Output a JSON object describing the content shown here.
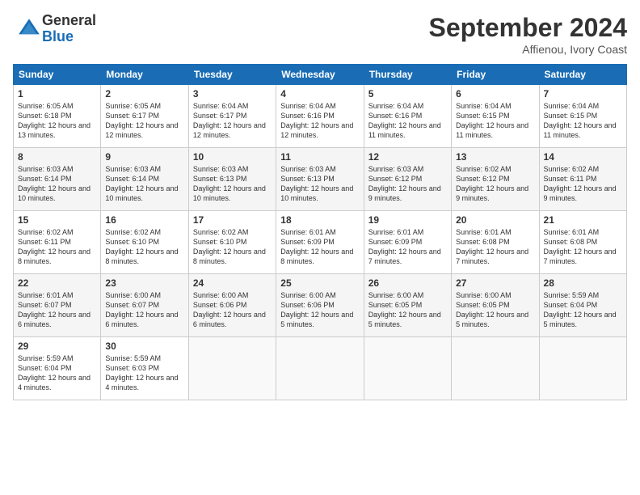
{
  "logo": {
    "general": "General",
    "blue": "Blue"
  },
  "title": "September 2024",
  "location": "Affienou, Ivory Coast",
  "headers": [
    "Sunday",
    "Monday",
    "Tuesday",
    "Wednesday",
    "Thursday",
    "Friday",
    "Saturday"
  ],
  "weeks": [
    [
      {
        "day": "1",
        "rise": "6:05 AM",
        "set": "6:18 PM",
        "daylight": "12 hours and 13 minutes."
      },
      {
        "day": "2",
        "rise": "6:05 AM",
        "set": "6:17 PM",
        "daylight": "12 hours and 12 minutes."
      },
      {
        "day": "3",
        "rise": "6:04 AM",
        "set": "6:17 PM",
        "daylight": "12 hours and 12 minutes."
      },
      {
        "day": "4",
        "rise": "6:04 AM",
        "set": "6:16 PM",
        "daylight": "12 hours and 12 minutes."
      },
      {
        "day": "5",
        "rise": "6:04 AM",
        "set": "6:16 PM",
        "daylight": "12 hours and 11 minutes."
      },
      {
        "day": "6",
        "rise": "6:04 AM",
        "set": "6:15 PM",
        "daylight": "12 hours and 11 minutes."
      },
      {
        "day": "7",
        "rise": "6:04 AM",
        "set": "6:15 PM",
        "daylight": "12 hours and 11 minutes."
      }
    ],
    [
      {
        "day": "8",
        "rise": "6:03 AM",
        "set": "6:14 PM",
        "daylight": "12 hours and 10 minutes."
      },
      {
        "day": "9",
        "rise": "6:03 AM",
        "set": "6:14 PM",
        "daylight": "12 hours and 10 minutes."
      },
      {
        "day": "10",
        "rise": "6:03 AM",
        "set": "6:13 PM",
        "daylight": "12 hours and 10 minutes."
      },
      {
        "day": "11",
        "rise": "6:03 AM",
        "set": "6:13 PM",
        "daylight": "12 hours and 10 minutes."
      },
      {
        "day": "12",
        "rise": "6:03 AM",
        "set": "6:12 PM",
        "daylight": "12 hours and 9 minutes."
      },
      {
        "day": "13",
        "rise": "6:02 AM",
        "set": "6:12 PM",
        "daylight": "12 hours and 9 minutes."
      },
      {
        "day": "14",
        "rise": "6:02 AM",
        "set": "6:11 PM",
        "daylight": "12 hours and 9 minutes."
      }
    ],
    [
      {
        "day": "15",
        "rise": "6:02 AM",
        "set": "6:11 PM",
        "daylight": "12 hours and 8 minutes."
      },
      {
        "day": "16",
        "rise": "6:02 AM",
        "set": "6:10 PM",
        "daylight": "12 hours and 8 minutes."
      },
      {
        "day": "17",
        "rise": "6:02 AM",
        "set": "6:10 PM",
        "daylight": "12 hours and 8 minutes."
      },
      {
        "day": "18",
        "rise": "6:01 AM",
        "set": "6:09 PM",
        "daylight": "12 hours and 8 minutes."
      },
      {
        "day": "19",
        "rise": "6:01 AM",
        "set": "6:09 PM",
        "daylight": "12 hours and 7 minutes."
      },
      {
        "day": "20",
        "rise": "6:01 AM",
        "set": "6:08 PM",
        "daylight": "12 hours and 7 minutes."
      },
      {
        "day": "21",
        "rise": "6:01 AM",
        "set": "6:08 PM",
        "daylight": "12 hours and 7 minutes."
      }
    ],
    [
      {
        "day": "22",
        "rise": "6:01 AM",
        "set": "6:07 PM",
        "daylight": "12 hours and 6 minutes."
      },
      {
        "day": "23",
        "rise": "6:00 AM",
        "set": "6:07 PM",
        "daylight": "12 hours and 6 minutes."
      },
      {
        "day": "24",
        "rise": "6:00 AM",
        "set": "6:06 PM",
        "daylight": "12 hours and 6 minutes."
      },
      {
        "day": "25",
        "rise": "6:00 AM",
        "set": "6:06 PM",
        "daylight": "12 hours and 5 minutes."
      },
      {
        "day": "26",
        "rise": "6:00 AM",
        "set": "6:05 PM",
        "daylight": "12 hours and 5 minutes."
      },
      {
        "day": "27",
        "rise": "6:00 AM",
        "set": "6:05 PM",
        "daylight": "12 hours and 5 minutes."
      },
      {
        "day": "28",
        "rise": "5:59 AM",
        "set": "6:04 PM",
        "daylight": "12 hours and 5 minutes."
      }
    ],
    [
      {
        "day": "29",
        "rise": "5:59 AM",
        "set": "6:04 PM",
        "daylight": "12 hours and 4 minutes."
      },
      {
        "day": "30",
        "rise": "5:59 AM",
        "set": "6:03 PM",
        "daylight": "12 hours and 4 minutes."
      },
      null,
      null,
      null,
      null,
      null
    ]
  ]
}
